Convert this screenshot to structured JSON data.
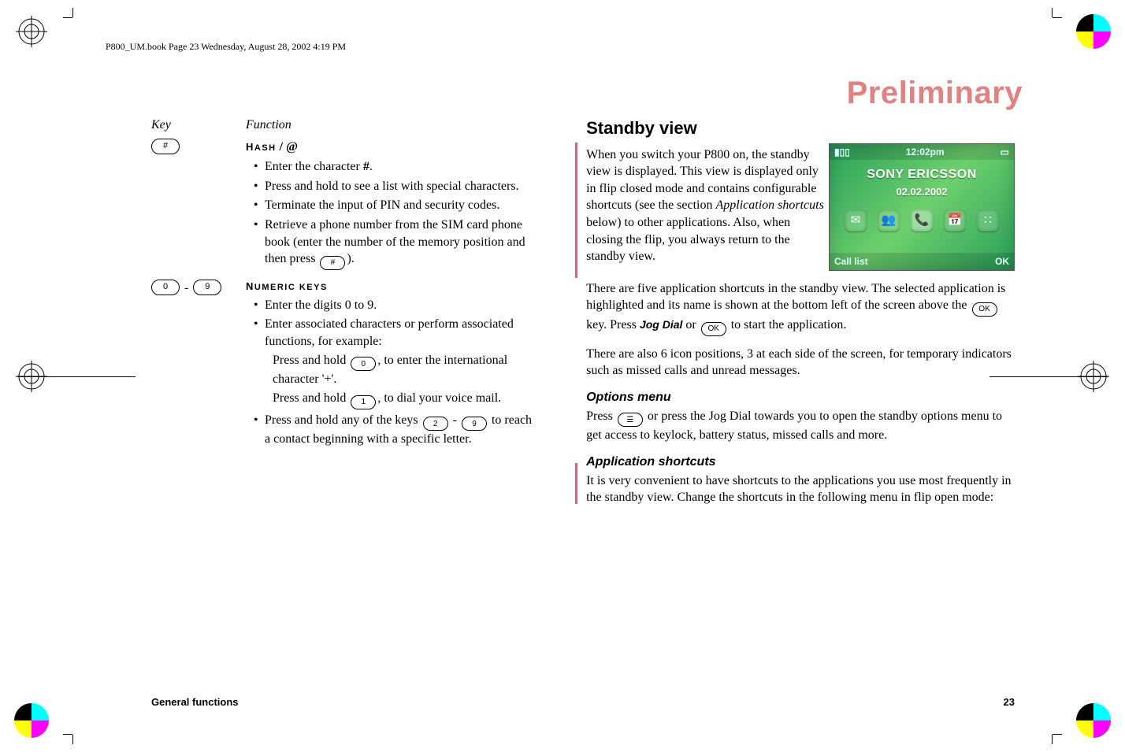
{
  "book_header": "P800_UM.book  Page 23  Wednesday, August 28, 2002  4:19 PM",
  "watermark": "Preliminary",
  "table_header": {
    "key": "Key",
    "function": "Function"
  },
  "hash_row": {
    "key_glyph": "#",
    "title_prefix": "H",
    "title_rest": "ASH",
    "title_sep": " / ",
    "title_at": "@",
    "b1_pre": "Enter the character ",
    "b1_hash": "#",
    "b1_post": ".",
    "b2": "Press and hold to see a list with special characters.",
    "b3": "Terminate the input of PIN and security codes.",
    "b4_pre": "Retrieve a phone number from the SIM card phone book (enter the number of the memory position and then press ",
    "b4_key": "#",
    "b4_post": ")."
  },
  "num_row": {
    "key0": "0",
    "key_dash": " - ",
    "key9": "9",
    "title_prefix": "N",
    "title_rest": "UMERIC KEYS",
    "b1": "Enter the digits 0 to 9.",
    "b2": "Enter associated characters or perform associated functions, for example:",
    "sub1_pre": "Press and hold ",
    "sub1_key": "0",
    "sub1_post": ", to enter the international character '+'.",
    "sub2_pre": "Press and hold ",
    "sub2_key": "1",
    "sub2_post": ", to dial your voice mail.",
    "b3_pre": "Press and hold any of the keys ",
    "b3_k2": "2",
    "b3_dash": " - ",
    "b3_k9": "9",
    "b3_post": " to reach a contact beginning with a specific letter."
  },
  "right": {
    "heading": "Standby view",
    "p1_pre": "When you switch your P800 on, the standby view is displayed. This view is displayed only in flip closed mode and contains configurable shortcuts (see the section ",
    "p1_ital": "Application shortcuts",
    "p1_post": " below) to other applications. Also, when closing the flip, you always return to the standby view.",
    "p2_pre": "There are five application shortcuts in the standby view. The selected application is highlighted and its name is shown at the bottom left of the screen above the ",
    "p2_key1": "OK",
    "p2_mid": " key. Press ",
    "p2_jog": "Jog Dial",
    "p2_or": " or ",
    "p2_key2": "OK",
    "p2_post": " to start the application.",
    "p3": "There are also 6 icon positions, 3 at each side of the screen, for temporary indicators such as missed calls and unread messages.",
    "sub1": "Options menu",
    "p4_pre": "Press ",
    "p4_key": "☰",
    "p4_post": " or press the Jog Dial towards you to open the standby options menu to get access to keylock, battery status, missed calls and more.",
    "sub2": "Application shortcuts",
    "p5": "It is very convenient to have shortcuts to the applications you use most frequently in the standby view. Change the shortcuts in the following menu in flip open mode:"
  },
  "screen": {
    "signal": "▮▯▯",
    "time": "12:02pm",
    "batt": "▭",
    "brand": "SONY ERICSSON",
    "date": "02.02.2002",
    "label": "Call list",
    "ok": "OK"
  },
  "footer": {
    "left": "General functions",
    "right": "23"
  }
}
